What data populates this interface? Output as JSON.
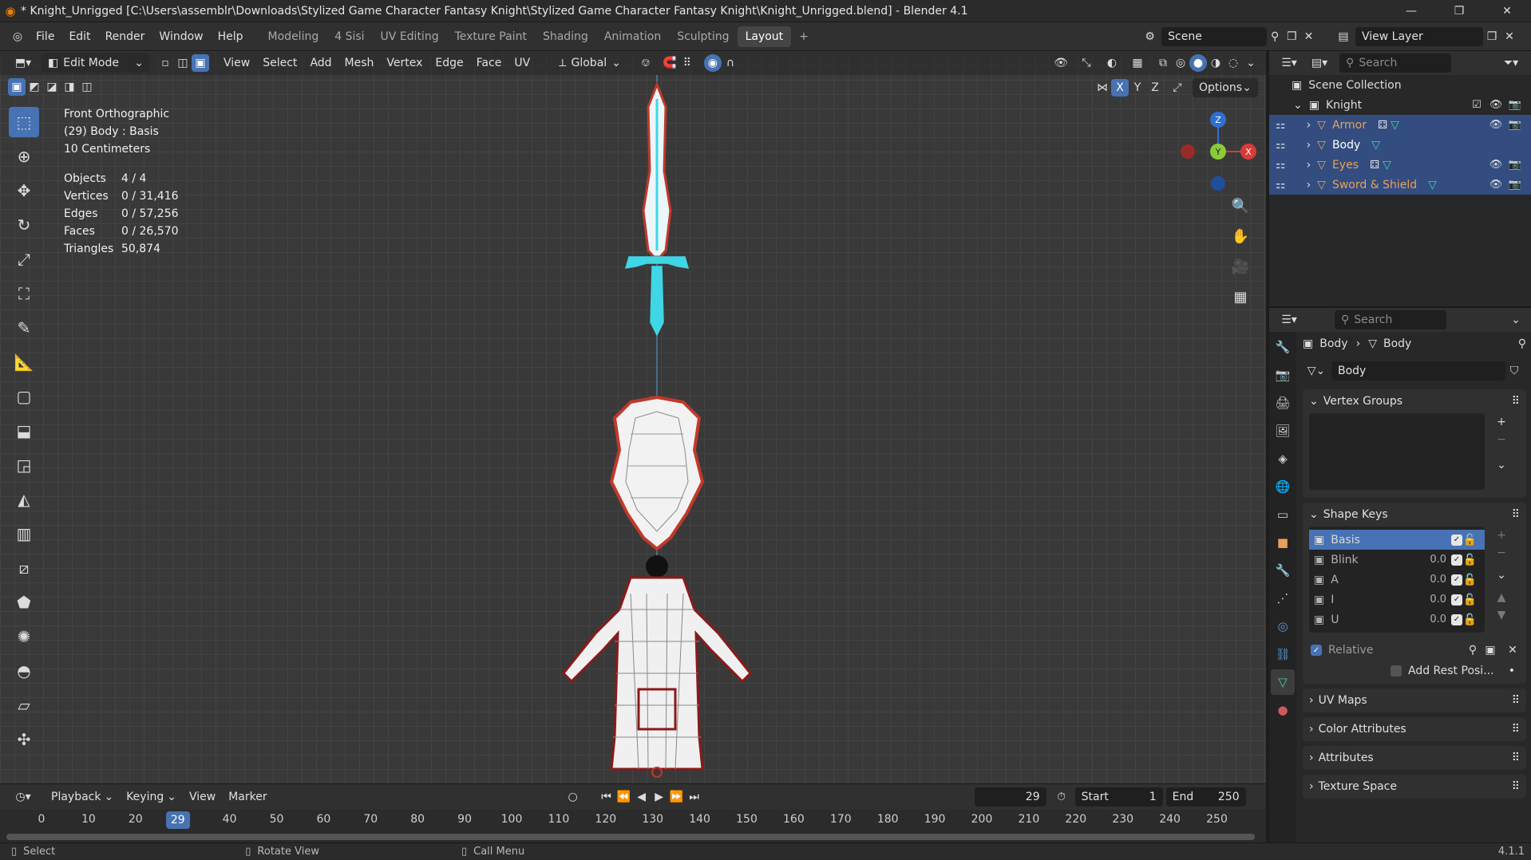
{
  "window": {
    "title": "* Knight_Unrigged [C:\\Users\\assemblr\\Downloads\\Stylized Game Character Fantasy Knight\\Stylized Game Character Fantasy Knight\\Knight_Unrigged.blend] - Blender 4.1",
    "minimize": "—",
    "maximize": "❐",
    "close": "✕"
  },
  "menu": [
    "File",
    "Edit",
    "Render",
    "Window",
    "Help"
  ],
  "workspaces": [
    "Modeling",
    "4 Sisi",
    "UV Editing",
    "Texture Paint",
    "Shading",
    "Animation",
    "Sculpting",
    "Layout"
  ],
  "active_workspace": "Layout",
  "scene": "Scene",
  "view_layer": "View Layer",
  "viewport_header": {
    "mode": "Edit Mode",
    "menus": [
      "View",
      "Select",
      "Add",
      "Mesh",
      "Vertex",
      "Edge",
      "Face",
      "UV"
    ],
    "orientation": "Global",
    "options": "Options",
    "axes": [
      "X",
      "Y",
      "Z"
    ]
  },
  "overlay": {
    "view_name": "Front Orthographic",
    "object_info": "(29) Body : Basis",
    "scale": "10 Centimeters"
  },
  "stats": [
    {
      "k": "Objects",
      "v": "4 / 4"
    },
    {
      "k": "Vertices",
      "v": "0 / 31,416"
    },
    {
      "k": "Edges",
      "v": "0 / 57,256"
    },
    {
      "k": "Faces",
      "v": "0 / 26,570"
    },
    {
      "k": "Triangles",
      "v": "50,874"
    }
  ],
  "gizmo": {
    "z": "Z",
    "y": "Y",
    "x": "X"
  },
  "outliner": {
    "search_placeholder": "Search",
    "root": "Scene Collection",
    "collection": "Knight",
    "items": [
      "Armor",
      "Body",
      "Eyes",
      "Sword & Shield"
    ]
  },
  "properties": {
    "search_placeholder": "Search",
    "breadcrumb_object": "Body",
    "breadcrumb_data": "Body",
    "data_name": "Body",
    "vertex_groups_title": "Vertex Groups",
    "shape_keys_title": "Shape Keys",
    "shape_keys": [
      {
        "name": "Basis",
        "value": ""
      },
      {
        "name": "Blink",
        "value": "0.0"
      },
      {
        "name": "A",
        "value": "0.0"
      },
      {
        "name": "I",
        "value": "0.0"
      },
      {
        "name": "U",
        "value": "0.0"
      }
    ],
    "relative_label": "Relative",
    "add_rest_label": "Add Rest Posi...",
    "collapsed_panels": [
      "UV Maps",
      "Color Attributes",
      "Attributes",
      "Texture Space"
    ]
  },
  "timeline": {
    "menus": [
      "Playback",
      "Keying",
      "View",
      "Marker"
    ],
    "current_frame": "29",
    "start_label": "Start",
    "start": "1",
    "end_label": "End",
    "end": "250",
    "ticks": [
      "0",
      "10",
      "20",
      "40",
      "50",
      "60",
      "70",
      "80",
      "90",
      "100",
      "110",
      "120",
      "130",
      "140",
      "150",
      "160",
      "170",
      "180",
      "190",
      "200",
      "210",
      "220",
      "230",
      "240",
      "250"
    ]
  },
  "status": {
    "select": "Select",
    "rotate": "Rotate View",
    "menu": "Call Menu",
    "version": "4.1.1"
  },
  "colors": {
    "accent": "#4772b3",
    "wire_red": "#c0392b",
    "wire_cyan": "#3fd6e6",
    "outliner_orange": "#e8a05a"
  }
}
